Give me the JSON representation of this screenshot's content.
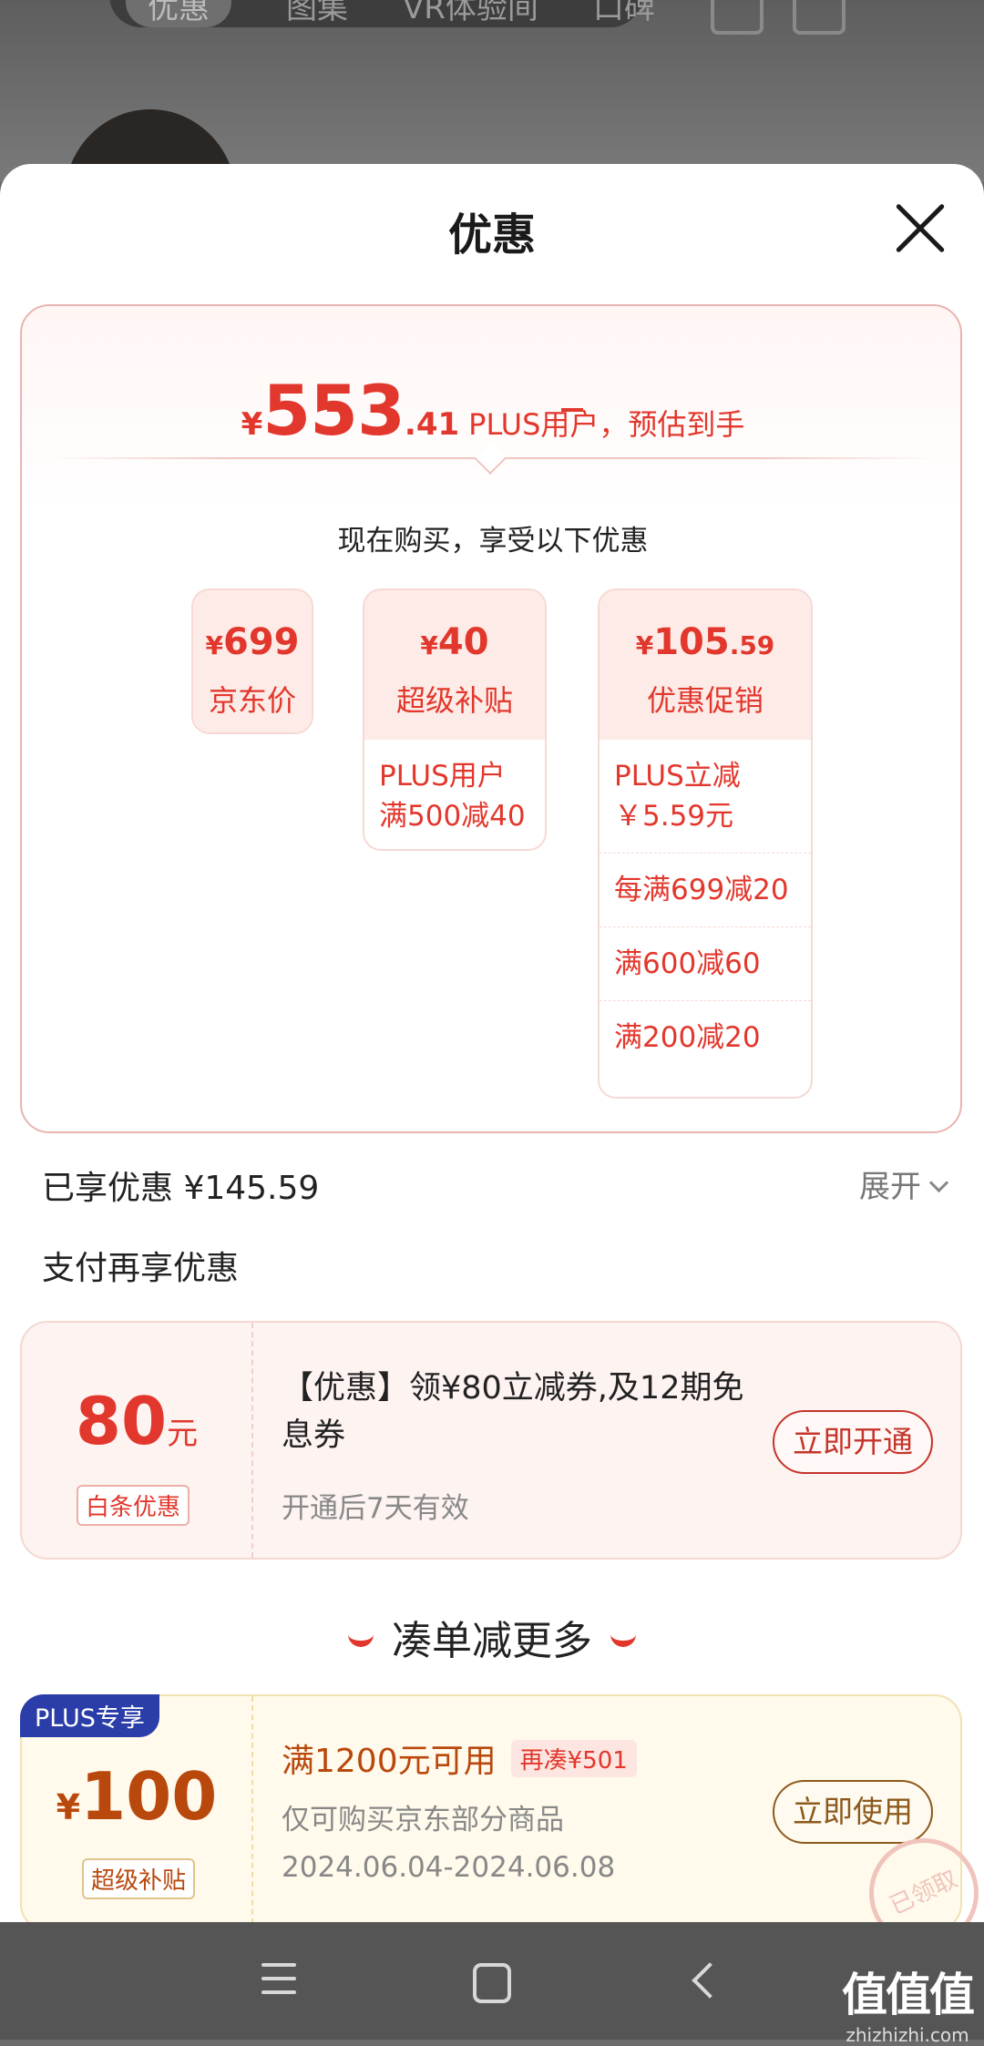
{
  "background": {
    "tabs": [
      "优惠",
      "图集",
      "VR体验间",
      "口碑"
    ]
  },
  "sheet": {
    "title": "优惠"
  },
  "estimate": {
    "currency": "¥",
    "integer": "553",
    "decimal": ".41",
    "label": "PLUS用户，预估到手",
    "subtitle": "现在购买，享受以下优惠"
  },
  "price_cards": [
    {
      "currency": "¥",
      "value": "699",
      "decimal": "",
      "name": "京东价",
      "details": []
    },
    {
      "currency": "¥",
      "value": "40",
      "decimal": "",
      "name": "超级补贴",
      "details": [
        "PLUS用户满500减40"
      ]
    },
    {
      "currency": "¥",
      "value": "105",
      "decimal": ".59",
      "name": "优惠促销",
      "details": [
        "PLUS立减 ￥5.59元",
        "每满699减20",
        "满600减60",
        "满200减20"
      ]
    }
  ],
  "enjoyed": {
    "label": "已享优惠 ¥145.59",
    "expand": "展开"
  },
  "pay_title": "支付再享优惠",
  "pay_coupon": {
    "amount": "80",
    "unit": "元",
    "tag": "白条优惠",
    "description": "【优惠】领¥80立减券,及12期免息券",
    "validity": "开通后7天有效",
    "button": "立即开通"
  },
  "more_title": "凑单减更多",
  "more_coupon": {
    "plus_tag": "PLUS专享",
    "currency": "¥",
    "amount": "100",
    "tag": "超级补贴",
    "condition": "满1200元可用",
    "badge": "再凑¥501",
    "scope": "仅可购买京东部分商品",
    "date": "2024.06.04-2024.06.08",
    "button": "立即使用",
    "stamp": "已领取"
  },
  "watermark": {
    "logo": "值值值",
    "site": "zhizhizhi.com"
  },
  "colors": {
    "accent_red": "#e2372c",
    "gold": "#b9480d",
    "plus_blue": "#2a3da8"
  }
}
